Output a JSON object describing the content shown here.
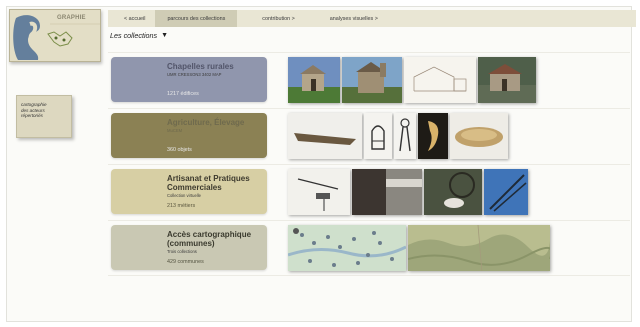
{
  "nav": [
    {
      "label": "< accueil"
    },
    {
      "label": "parcours des collections",
      "active": true
    },
    {
      "label": "contribution >"
    },
    {
      "label": "analyses visuelles >"
    }
  ],
  "logo": {
    "text": "GRAPHIE"
  },
  "sidebar": {
    "lines": [
      "cartographie",
      "des acteurs",
      "répertoriés"
    ]
  },
  "section": {
    "title": "Les collections",
    "toggle_icon": "triangle-down-icon"
  },
  "collections": [
    {
      "title": "Chapelles rurales",
      "subtitle": "UMR CRESSON3 3402 MAP",
      "count": "1217 édifices",
      "color": "#9096ad",
      "title_color": "#52556a",
      "thumb_count": 4
    },
    {
      "title": "Agriculture, Élevage",
      "subtitle": "MuCEM",
      "count": "360 objets",
      "color": "#8b8154",
      "title_color": "#6f6a4d",
      "thumb_count": 5
    },
    {
      "title": "Artisanat et Pratiques Commerciales",
      "subtitle": "Collection virtuelle",
      "count": "213 métiers",
      "color": "#d7cfa4",
      "title_color": "#3d3a2e",
      "thumb_count": 5
    },
    {
      "title": "Accès cartographique (communes)",
      "subtitle": "Trois collections",
      "count": "429 communes",
      "color": "#c9c8b3",
      "title_color": "#3a3a2e",
      "thumb_count": 2
    }
  ]
}
